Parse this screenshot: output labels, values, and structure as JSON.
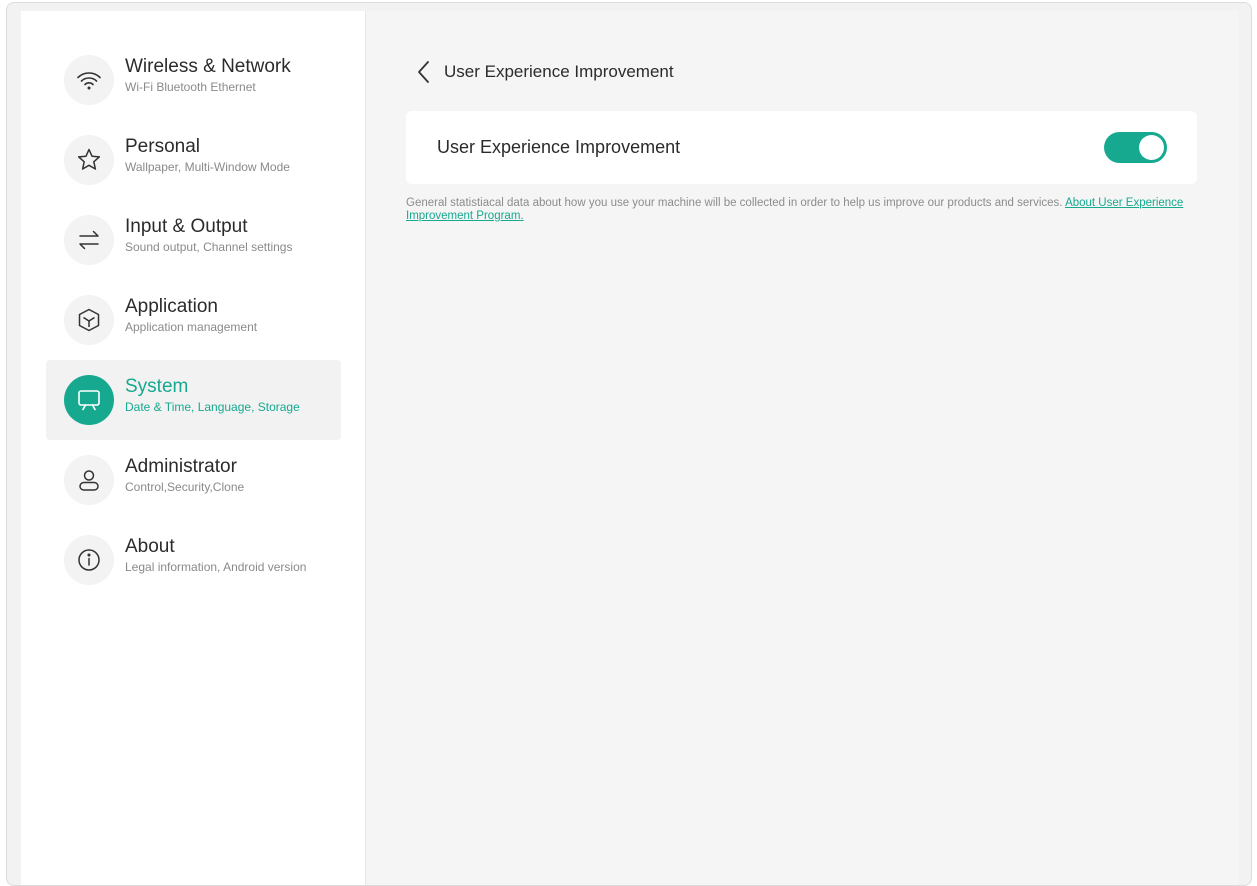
{
  "sidebar": {
    "items": [
      {
        "title": "Wireless & Network",
        "subtitle": "Wi-Fi Bluetooth Ethernet",
        "icon": "wifi-icon",
        "active": false
      },
      {
        "title": "Personal",
        "subtitle": "Wallpaper, Multi-Window Mode",
        "icon": "star-icon",
        "active": false
      },
      {
        "title": "Input & Output",
        "subtitle": "Sound output, Channel settings",
        "icon": "swap-arrows-icon",
        "active": false
      },
      {
        "title": "Application",
        "subtitle": "Application management",
        "icon": "cube-icon",
        "active": false
      },
      {
        "title": "System",
        "subtitle": "Date & Time, Language, Storage",
        "icon": "monitor-icon",
        "active": true
      },
      {
        "title": "Administrator",
        "subtitle": "Control,Security,Clone",
        "icon": "user-icon",
        "active": false
      },
      {
        "title": "About",
        "subtitle": "Legal information, Android version",
        "icon": "info-icon",
        "active": false
      }
    ]
  },
  "header": {
    "back_icon": "chevron-left-icon",
    "title": "User Experience Improvement"
  },
  "setting": {
    "label": "User Experience Improvement",
    "toggle_state": "on"
  },
  "description": {
    "text": "General statistiacal data about how you use your machine will be collected in order to help us improve our products and services. ",
    "link": "About User Experience Improvement Program."
  },
  "colors": {
    "accent": "#16a98f",
    "sidebar_bg": "#ffffff",
    "main_bg": "#f5f5f5"
  }
}
